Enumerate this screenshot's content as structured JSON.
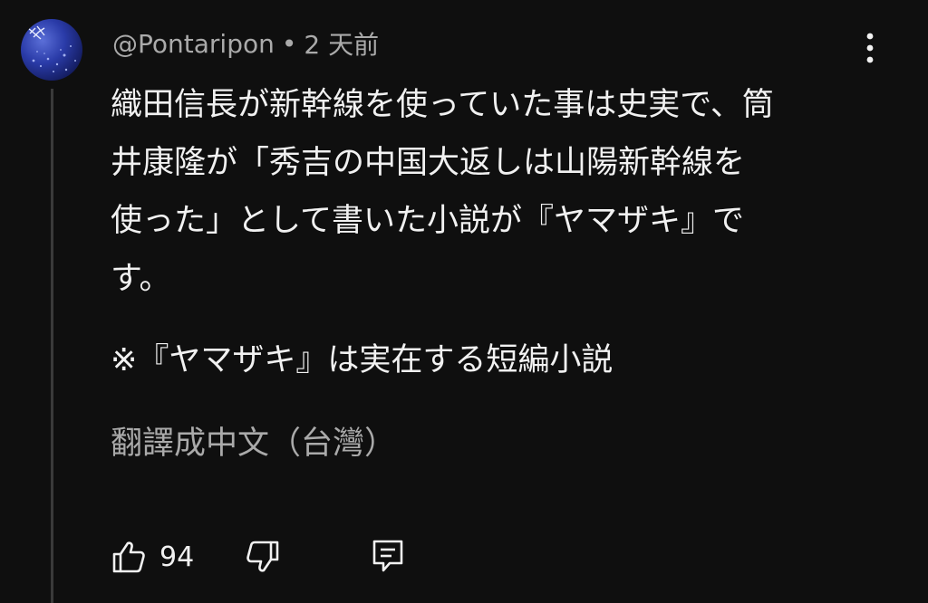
{
  "comment": {
    "author": "@Pontaripon",
    "separator": "•",
    "time": "2 天前",
    "lines": [
      "織田信長が新幹線を使っていた事は史実で、筒",
      "井康隆が「秀吉の中国大返しは山陽新幹線を",
      "使った」として書いた小説が『ヤマザキ』で",
      "す。"
    ],
    "note": "※『ヤマザキ』は実在する短編小説",
    "translate_label": "翻譯成中文（台灣）",
    "like_count": "94"
  },
  "icons": {
    "avatar": "avatar-image",
    "more": "more-vert-icon",
    "like": "thumb-up-icon",
    "dislike": "thumb-down-icon",
    "reply": "reply-comment-icon"
  }
}
